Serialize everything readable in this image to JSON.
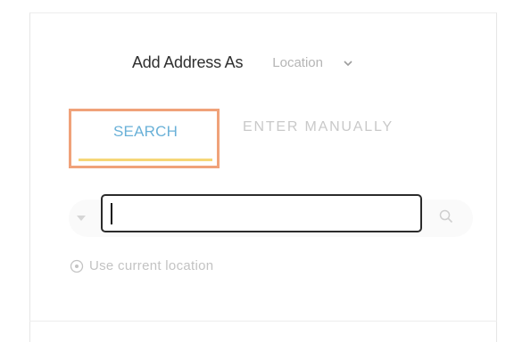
{
  "form": {
    "add_address_label": "Add Address As",
    "location_select": {
      "value": "Location",
      "icon": "chevron-down-icon"
    }
  },
  "tabs": [
    {
      "label": "SEARCH",
      "active": true
    },
    {
      "label": "ENTER MANUALLY",
      "active": false
    }
  ],
  "search": {
    "value": "",
    "placeholder": "",
    "dropdown_icon": "caret-down-icon",
    "search_icon": "search-icon"
  },
  "current_location": {
    "label": "Use current location",
    "icon": "location-icon"
  },
  "colors": {
    "active_tab_text": "#6ab1d8",
    "active_tab_underline": "#f6d777",
    "highlight_border": "#f0a27a",
    "input_border": "#2b2b2b",
    "muted_text": "#c3c3c3"
  }
}
